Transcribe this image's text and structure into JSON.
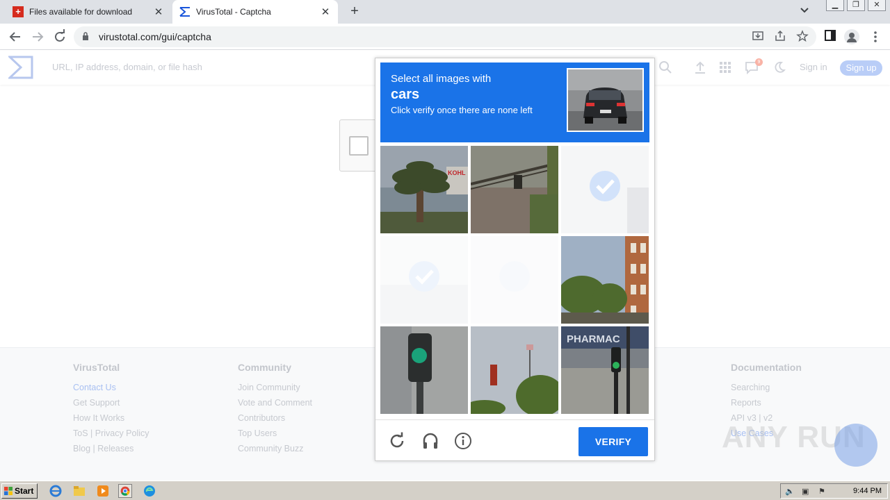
{
  "browser": {
    "tabs": [
      {
        "title": "Files available for download",
        "favicon": "swiss-flag-icon"
      },
      {
        "title": "VirusTotal - Captcha",
        "favicon": "virustotal-icon"
      }
    ],
    "new_tab_symbol": "+",
    "close_symbol": "✕",
    "url": "virustotal.com/gui/captcha"
  },
  "vt": {
    "search_placeholder": "URL, IP address, domain, or file hash",
    "notification_count": "9",
    "signin": "Sign in",
    "signup": "Sign up"
  },
  "captcha": {
    "instruction_line1": "Select all images with",
    "target": "cars",
    "instruction_line3": "Click verify once there are none left",
    "verify_label": "VERIFY",
    "tile_texts": {
      "store_sign": "KOHL",
      "pharmacy_sign": "PHARMAC"
    },
    "accent_color": "#1a73e8"
  },
  "footer": {
    "columns": [
      {
        "heading": "VirusTotal",
        "links": [
          "Contact Us",
          "Get Support",
          "How It Works",
          "ToS | Privacy Policy",
          "Blog | Releases"
        ]
      },
      {
        "heading": "Community",
        "links": [
          "Join Community",
          "Vote and Comment",
          "Contributors",
          "Top Users",
          "Community Buzz"
        ]
      },
      {
        "heading": "Documentation",
        "links": [
          "Searching",
          "Reports",
          "API v3 | v2",
          "Use Cases"
        ]
      }
    ]
  },
  "watermark": "ANY RUN",
  "taskbar": {
    "start_label": "Start",
    "clock": "9:44 PM"
  }
}
